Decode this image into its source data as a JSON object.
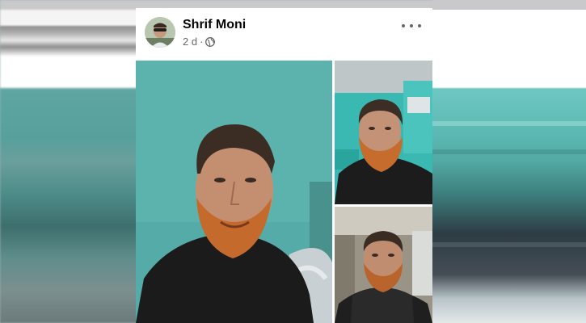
{
  "post": {
    "author": "Shrif Moni",
    "time": "2 d",
    "separator": "·",
    "privacy_icon": "globe-icon",
    "menu_icon": "more-options-icon"
  },
  "photos": [
    {
      "description_icon": "selfie-photo-main"
    },
    {
      "description_icon": "selfie-photo-top-right"
    },
    {
      "description_icon": "selfie-photo-bottom-right"
    }
  ]
}
